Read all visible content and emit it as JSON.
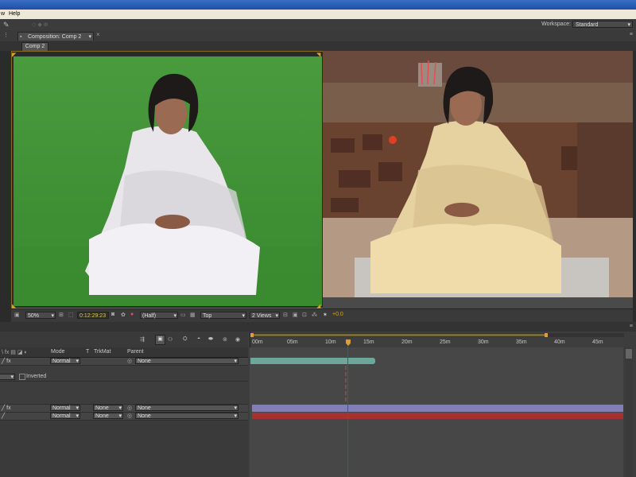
{
  "menu": {
    "items": [
      "w",
      "Help"
    ]
  },
  "workspace": {
    "label": "Workspace:",
    "value": "Standard"
  },
  "composition": {
    "tab_label": "Composition: Comp 2",
    "subtab_label": "Comp 2"
  },
  "viewer_bar": {
    "zoom": "50%",
    "timecode": "0:12:29:23",
    "resolution": "(Half)",
    "view": "Top",
    "views": "2 Views",
    "exposure": "+0.0"
  },
  "timeline": {
    "ruler_labels": [
      "00m",
      "05m",
      "10m",
      "15m",
      "20m",
      "25m",
      "30m",
      "35m",
      "40m",
      "45m"
    ],
    "columns": {
      "mode": "Mode",
      "t": "T",
      "trkmat": "TrkMat",
      "parent": "Parent"
    },
    "layers": [
      {
        "mode": "Normal",
        "trkmat": "",
        "parent": "None"
      },
      {
        "mode": "Normal",
        "trkmat": "None",
        "parent": "None"
      },
      {
        "mode": "Normal",
        "trkmat": "None",
        "parent": "None"
      }
    ],
    "mask_inverted_label": "Inverted"
  },
  "colors": {
    "accent": "#e0a020",
    "playhead": "#d02020",
    "bar_teal": "#6aa89a",
    "bar_purple": "#8080b8",
    "bar_red": "#a83030"
  }
}
